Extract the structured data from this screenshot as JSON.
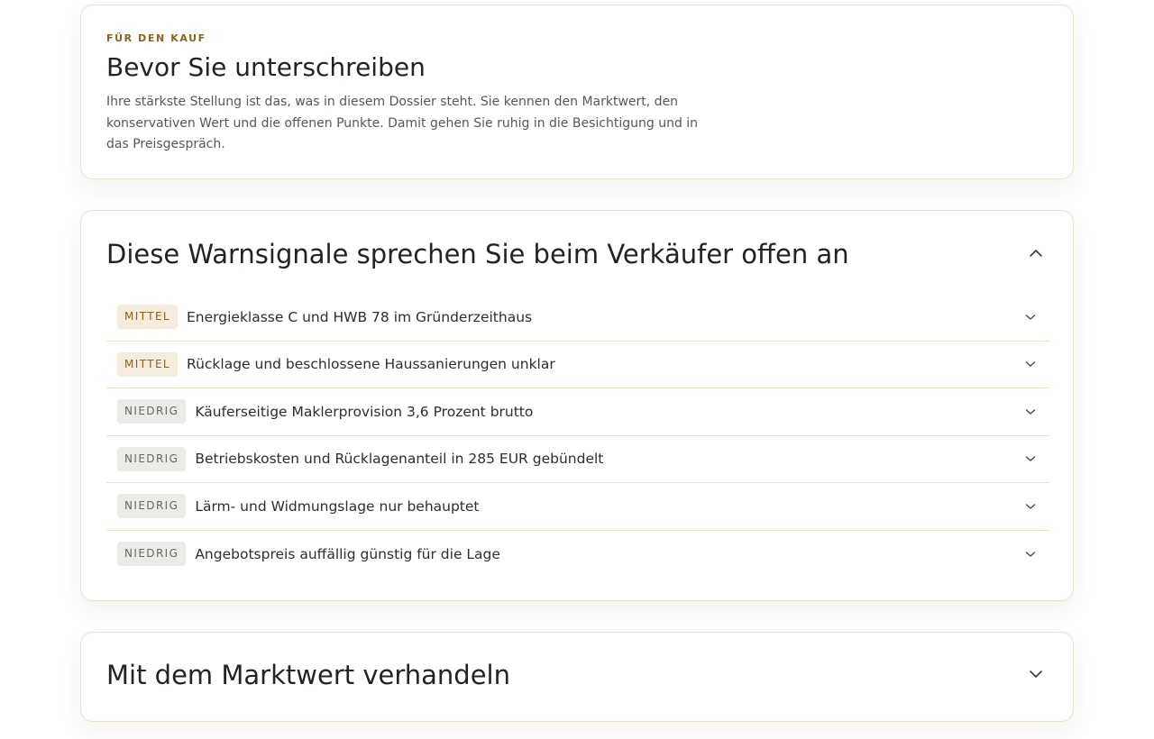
{
  "intro": {
    "eyebrow": "FÜR DEN KAUF",
    "title": "Bevor Sie unterschreiben",
    "text": "Ihre stärkste Stellung ist das, was in diesem Dossier steht. Sie kennen den Marktwert, den konservativen Wert und die offenen Punkte. Damit gehen Sie ruhig in die Besichtigung und in das Preisgespräch."
  },
  "warnings": {
    "title": "Diese Warnsignale sprechen Sie beim Verkäufer offen an",
    "expanded": true,
    "toggle_icon": "chevron-up-icon",
    "items": [
      {
        "severity": "MITTEL",
        "label": "Energieklasse C und HWB 78 im Gründerzeithaus"
      },
      {
        "severity": "MITTEL",
        "label": "Rücklage und beschlossene Haussanierungen unklar"
      },
      {
        "severity": "NIEDRIG",
        "label": "Käuferseitige Maklerprovision 3,6 Prozent brutto"
      },
      {
        "severity": "NIEDRIG",
        "label": "Betriebskosten und Rücklagenanteil in 285 EUR gebündelt"
      },
      {
        "severity": "NIEDRIG",
        "label": "Lärm- und Widmungslage nur behauptet"
      },
      {
        "severity": "NIEDRIG",
        "label": "Angebotspreis auffällig günstig für die Lage"
      }
    ],
    "item_icon": "chevron-down-icon"
  },
  "market": {
    "title": "Mit dem Marktwert verhandeln",
    "expanded": false,
    "toggle_icon": "chevron-down-icon"
  },
  "colors": {
    "accent": "#8a6420",
    "mittel_bg": "#f4ecdc",
    "niedrig_bg": "#ecebe7",
    "niedrig_text": "#6a6862",
    "border": "#e7e1cc"
  }
}
